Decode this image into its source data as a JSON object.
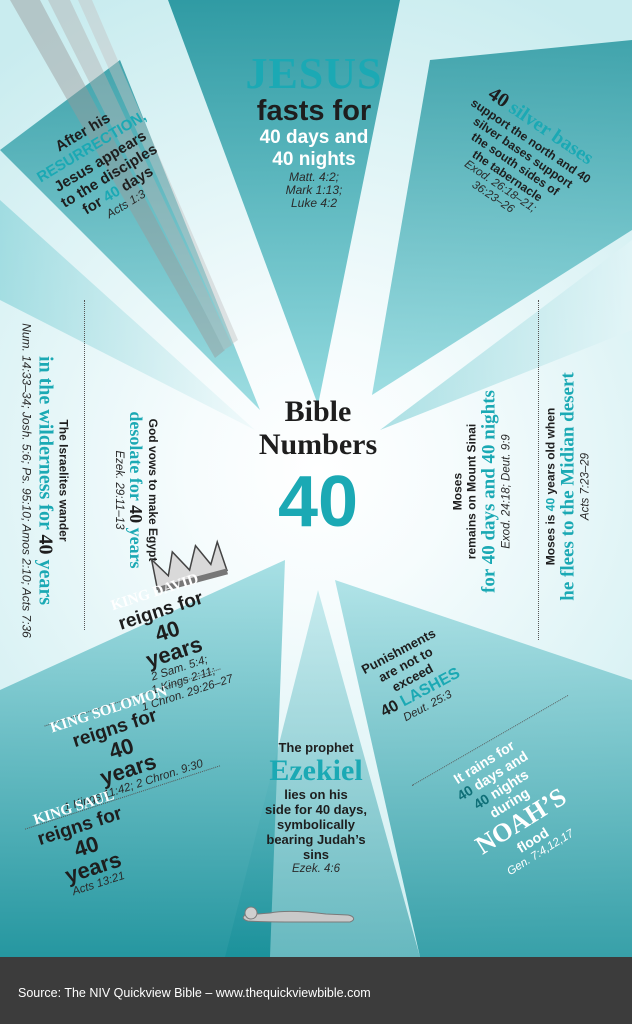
{
  "colors": {
    "teal": "#1ba9b4",
    "dark_teal": "#148c96",
    "text": "#1e1e1e",
    "footer_bg": "#3c3c3c"
  },
  "icons": {
    "crown": "crown-icon",
    "reclining_figure": "reclining-figure-icon"
  },
  "title": {
    "line1": "Bible",
    "line2": "Numbers",
    "number": "40"
  },
  "jesus": {
    "name": "JESUS",
    "line1": "fasts for",
    "line2": "40 days and",
    "line3": "40 nights",
    "ref1": "Matt. 4:2;",
    "ref2": "Mark 1:13;",
    "ref3": "Luke 4:2"
  },
  "resurrection": {
    "line1": "After his",
    "line2": "RESURRECTION,",
    "line3": "Jesus appears",
    "line4": "to the disciples",
    "line5_pre": "for ",
    "line5_num": "40",
    "line5_post": " days",
    "ref": "Acts 1:3"
  },
  "silver": {
    "head_num": "40",
    "head_text": " silver bases",
    "line1": "support the north and 40",
    "line2": "silver bases support",
    "line3": "the south sides of",
    "line4": "the tabernacle",
    "ref1": "Exod. 26:18–21;",
    "ref2": "36:23–26"
  },
  "wilderness": {
    "line1": "The Israelites wander",
    "line2_pre": "in the wilderness for ",
    "line2_num": "40",
    "line2_post": " years",
    "ref": "Num. 14:33–34; Josh. 5:6; Ps. 95:10; Amos 2:10; Acts 7:36"
  },
  "egypt": {
    "line1": "God vows to make Egypt",
    "line2_pre": "desolate for ",
    "line2_num": "40",
    "line2_post": " years",
    "ref": "Ezek. 29:11–13"
  },
  "sinai": {
    "line1": "Moses",
    "line2": "remains on Mount Sinai",
    "line3": "for 40 days and 40 nights",
    "ref": "Exod. 24:18; Deut. 9:9"
  },
  "midian": {
    "line1_pre": "Moses is ",
    "line1_num": "40",
    "line1_post": " years old when",
    "line2": "he flees to the Midian desert",
    "ref": "Acts 7:23–29"
  },
  "david": {
    "name": "KING DAVID",
    "line1": "reigns for",
    "line2": "40",
    "line3": "years",
    "ref1": "2 Sam. 5:4;",
    "ref2": "1 Kings 2:11;",
    "ref3": "1 Chron. 29:26–27"
  },
  "solomon": {
    "name": "KING SOLOMON",
    "line1": "reigns for",
    "line2": "40",
    "line3": "years",
    "ref": "1 Kings 11:42; 2 Chron. 9:30"
  },
  "saul": {
    "name": "KING SAUL",
    "line1": "reigns for",
    "line2": "40",
    "line3": "years",
    "ref": "Acts 13:21"
  },
  "lashes": {
    "line1": "Punishments",
    "line2": "are not to",
    "line3": "exceed",
    "line4_num": "40",
    "line4_text": " LASHES",
    "ref": "Deut. 25:3"
  },
  "ezekiel": {
    "line1": "The prophet",
    "name": "Ezekiel",
    "line2": "lies on his",
    "line3": "side for 40 days,",
    "line4": "symbolically",
    "line5": "bearing Judah’s",
    "line6": "sins",
    "ref": "Ezek. 4:6"
  },
  "noah": {
    "line1": "It rains for",
    "line2_num": "40",
    "line2_text": " days and",
    "line3_num": "40",
    "line3_text": " nights",
    "line4": "during",
    "name": "NOAH’S",
    "line5": "flood",
    "ref": "Gen. 7:4,12,17"
  },
  "footer": {
    "source": "Source: The NIV Quickview Bible – www.thequickviewbible.com"
  }
}
